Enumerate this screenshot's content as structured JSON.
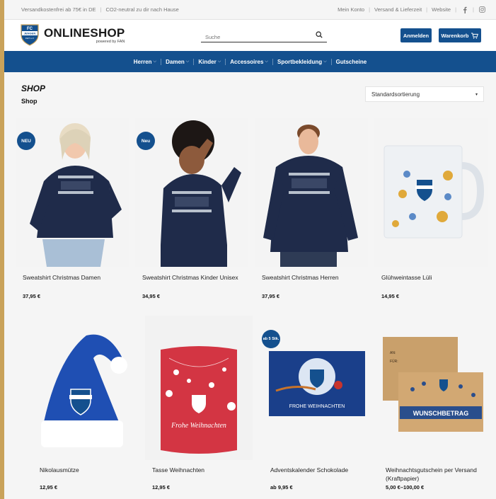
{
  "topbar": {
    "shipping_note": "Versandkostenfrei ab 75€ in DE",
    "co2_note": "CO2-neutral zu dir nach Hause",
    "links": [
      "Mein Konto",
      "Versand & Lieferzeit",
      "Website"
    ],
    "social_icons": [
      "facebook-icon",
      "instagram-icon"
    ]
  },
  "header": {
    "logo_text": "ONLINESHOP",
    "logo_sub": "powered by FAN",
    "crest_text": [
      "FC",
      "JENGEN",
      "1927 e.V."
    ],
    "search_placeholder": "Suche",
    "login_label": "Anmelden",
    "cart_label": "Warenkorb"
  },
  "nav": {
    "items": [
      {
        "label": "Herren",
        "has_dropdown": true
      },
      {
        "label": "Damen",
        "has_dropdown": true
      },
      {
        "label": "Kinder",
        "has_dropdown": true
      },
      {
        "label": "Accessoires",
        "has_dropdown": true
      },
      {
        "label": "Sportbekleidung",
        "has_dropdown": true
      },
      {
        "label": "Gutscheine",
        "has_dropdown": false
      }
    ]
  },
  "page": {
    "heading": "SHOP",
    "breadcrumb": "Shop",
    "sort_value": "Standardsortierung"
  },
  "products": [
    {
      "name": "Sweatshirt Christmas Damen",
      "price": "37,95 €",
      "badge": "NEU"
    },
    {
      "name": "Sweatshirt Christmas Kinder Unisex",
      "price": "34,95 €",
      "badge": "Neu"
    },
    {
      "name": "Sweatshirt Christmas Herren",
      "price": "37,95 €",
      "badge": ""
    },
    {
      "name": "Glühweintasse Lüli",
      "price": "14,95 €",
      "badge": ""
    },
    {
      "name": "Nikolausmütze",
      "price": "12,95 €",
      "badge": ""
    },
    {
      "name": "Tasse Weihnachten",
      "price": "12,95 €",
      "badge": "",
      "image_text": "Frohe Weihnachten"
    },
    {
      "name": "Adventskalender Schokolade",
      "price": "ab 9,95 €",
      "badge": "ab 5 Stk.",
      "image_text": "FROHE WEIHNACHTEN"
    },
    {
      "name": "Weihnachtsgutschein per Versand (Kraftpapier)",
      "price": "5,00 €–100,00 €",
      "badge": "",
      "image_text": "WUNSCHBETRAG",
      "image_small_text": [
        "AN:",
        "FÜR:"
      ]
    }
  ],
  "colors": {
    "brand_blue": "#14508e",
    "background": "#f5f5f5"
  }
}
